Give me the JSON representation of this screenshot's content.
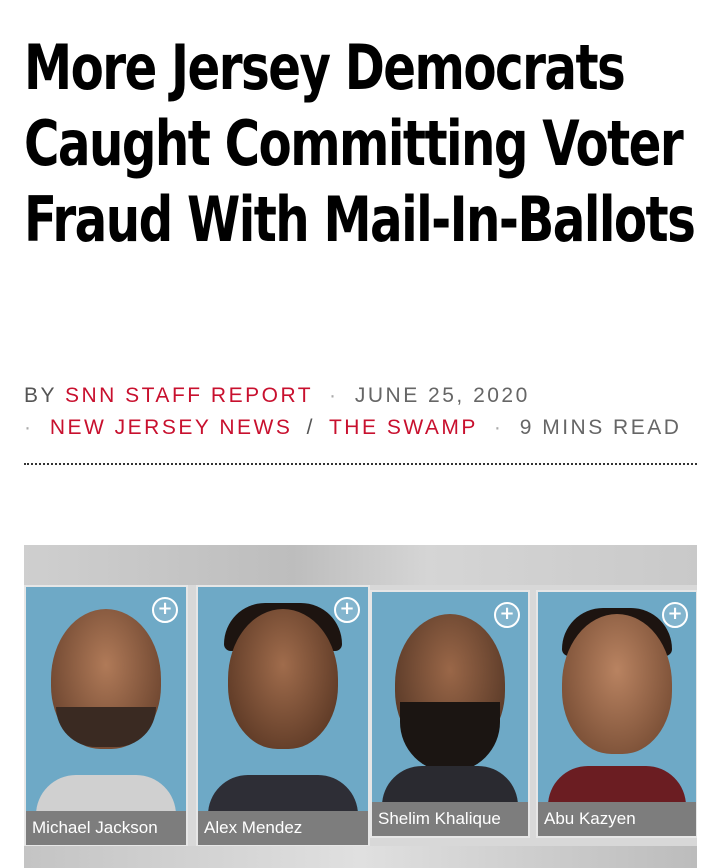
{
  "article": {
    "title": "More Jersey Democrats Caught Committing Voter Fraud With Mail-In-Ballots",
    "byline": {
      "by": "BY",
      "author": "SNN STAFF REPORT",
      "date": "JUNE 25, 2020",
      "categories": [
        "NEW JERSEY NEWS",
        "THE SWAMP"
      ],
      "read_time": "9 MINS READ",
      "separator": "·",
      "category_divider": "/"
    },
    "image": {
      "people": [
        {
          "name": "Michael Jackson",
          "icon": "plus-circle-icon"
        },
        {
          "name": "Alex Mendez",
          "icon": "plus-circle-icon"
        },
        {
          "name": "Shelim Khalique",
          "icon": "plus-circle-icon"
        },
        {
          "name": "Abu Kazyen",
          "icon": "plus-circle-icon"
        }
      ]
    }
  },
  "colors": {
    "accent": "#c8102e",
    "meta_text": "#555555",
    "card_bg": "#6ea9c6",
    "name_bar": "#7d7d7d"
  }
}
